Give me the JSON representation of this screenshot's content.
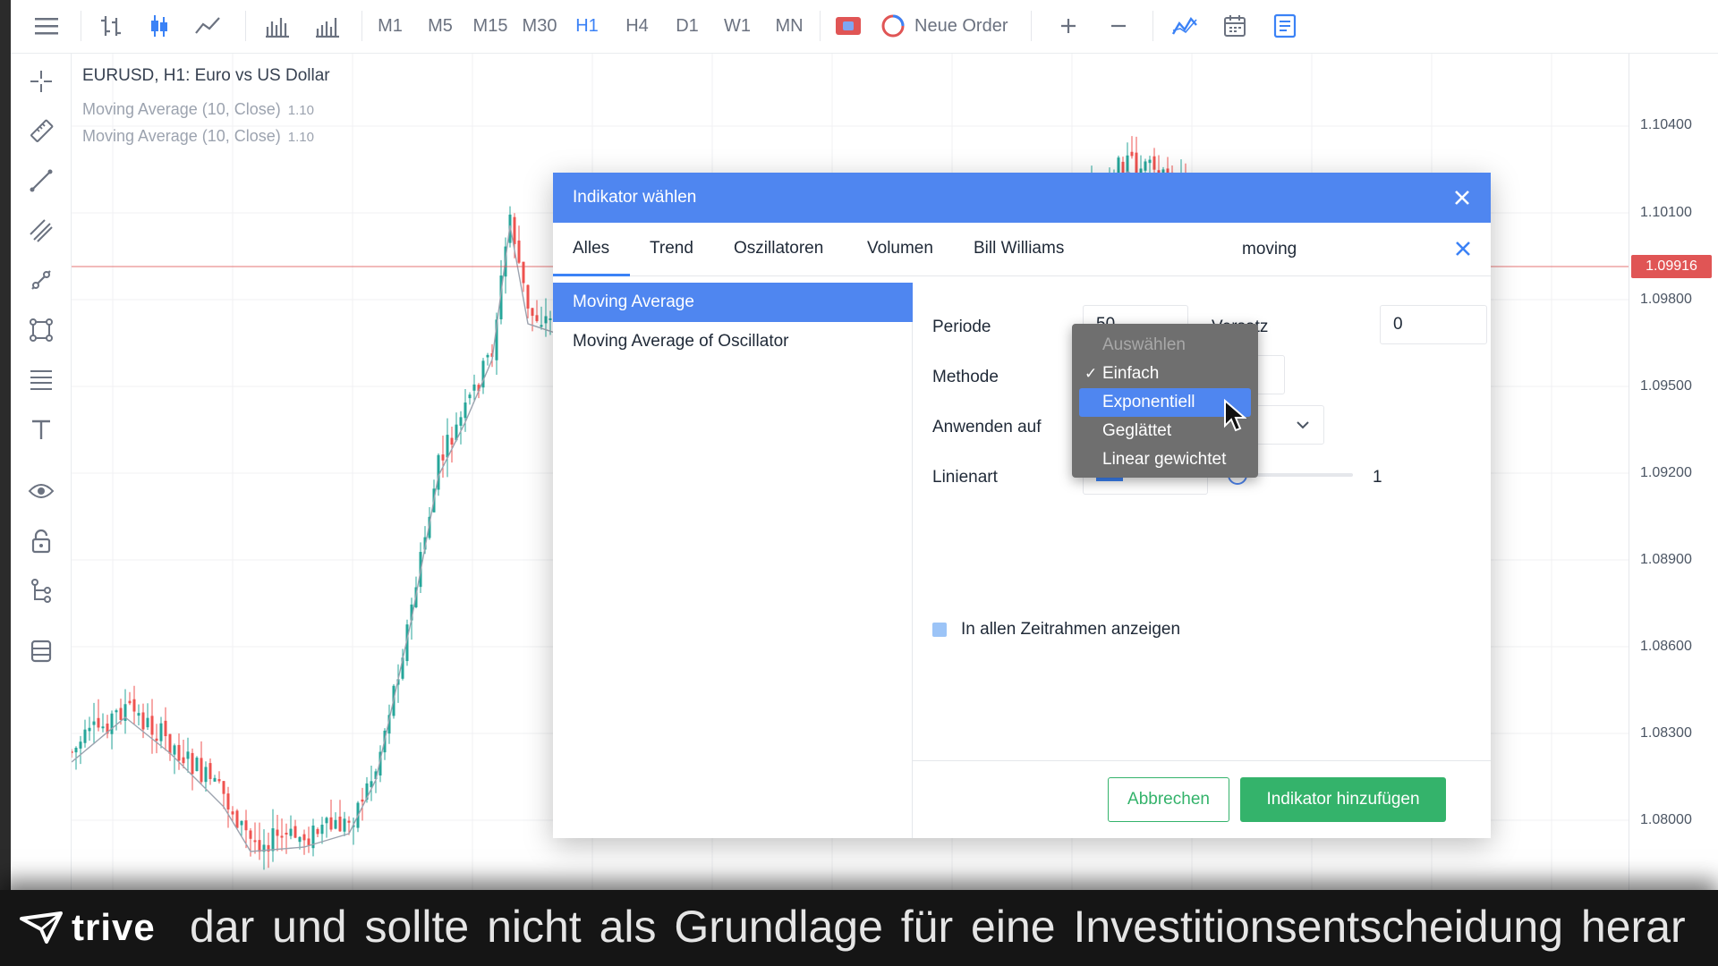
{
  "toolbar": {
    "menu_icon": "hamburger-menu-icon",
    "chart_types": [
      "bar-chart-icon",
      "candlestick-icon",
      "line-chart-icon",
      "volume-bars-icon",
      "volume-profile-icon"
    ],
    "timeframes": [
      "M1",
      "M5",
      "M15",
      "M30",
      "H1",
      "H4",
      "D1",
      "W1",
      "MN"
    ],
    "active_timeframe": "H1",
    "neue_order_label": "Neue Order",
    "actions": [
      "trade-toggle-icon",
      "order-icon",
      "zoom-in-icon",
      "zoom-out-icon",
      "indicators-icon",
      "calendar-icon",
      "report-icon"
    ]
  },
  "sidebar": {
    "tools": [
      "crosshair-icon",
      "ruler-icon",
      "trend-line-icon",
      "parallel-channel-icon",
      "ray-icon",
      "shapes-icon",
      "fibonacci-icon",
      "text-icon",
      "eye-icon",
      "lock-icon",
      "objects-tree-icon",
      "layers-icon"
    ]
  },
  "chart": {
    "symbol_title": "EURUSD, H1: Euro vs US Dollar",
    "indicators": [
      {
        "label": "Moving Average (10, Close)",
        "value": "1.10"
      },
      {
        "label": "Moving Average (10, Close)",
        "value": "1.10"
      }
    ],
    "price_ticks": [
      "1.10400",
      "1.10100",
      "1.09800",
      "1.09500",
      "1.09200",
      "1.08900",
      "1.08600",
      "1.08300",
      "1.08000"
    ],
    "current_price": "1.09916",
    "colors": {
      "bull": "#26a69a",
      "bear": "#ef5350",
      "ma": "#9ca3af",
      "price_line": "#e05555"
    }
  },
  "dialog": {
    "title": "Indikator wählen",
    "tabs": [
      "Alles",
      "Trend",
      "Oszillatoren",
      "Volumen",
      "Bill Williams"
    ],
    "active_tab": "Alles",
    "search_value": "moving",
    "results": [
      "Moving Average",
      "Moving Average of Oscillator"
    ],
    "selected_result": "Moving Average",
    "params": {
      "periode_label": "Periode",
      "periode_value": "50",
      "versatz_label": "Versatz",
      "versatz_value": "0",
      "methode_label": "Methode",
      "anwenden_label": "Anwenden auf",
      "linienart_label": "Linienart",
      "line_width_value": "1",
      "line_color": "#3b82f6",
      "all_timeframes_label": "In allen Zeitrahmen anzeigen"
    },
    "cancel_label": "Abbrechen",
    "add_label": "Indikator hinzufügen",
    "colors": {
      "header": "#4f86f0",
      "primary_button": "#34b36b"
    }
  },
  "method_dropdown": {
    "placeholder": "Auswählen",
    "options": [
      "Einfach",
      "Exponentiell",
      "Geglättet",
      "Linear gewichtet"
    ],
    "checked": "Einfach",
    "highlighted": "Exponentiell",
    "check_mark": "✓"
  },
  "banner": {
    "brand": "trive",
    "ticker": "dar und sollte nicht als Grundlage für eine Investitionsentscheidung herar"
  }
}
